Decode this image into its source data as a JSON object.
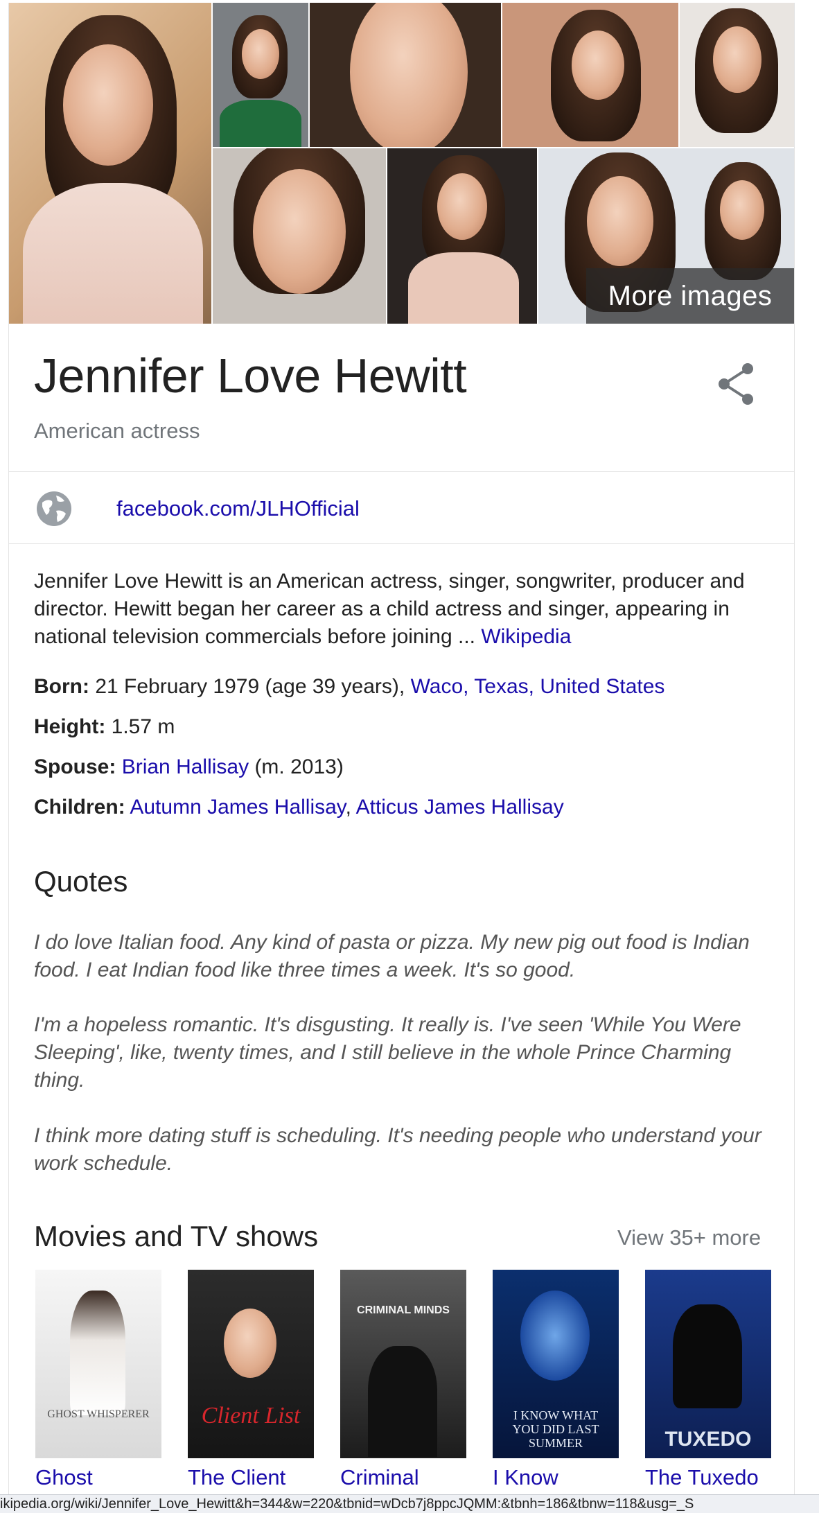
{
  "images": {
    "more_images_label": "More images"
  },
  "entity": {
    "name": "Jennifer Love Hewitt",
    "subtitle": "American actress",
    "website": "facebook.com/JLHOfficial",
    "description": "Jennifer Love Hewitt is an American actress, singer, songwriter, producer and director. Hewitt began her career as a child actress and singer, appearing in national television commercials before joining ... ",
    "description_source": "Wikipedia"
  },
  "facts": {
    "born": {
      "label": "Born:",
      "text": " 21 February 1979 (age 39 years), ",
      "link": "Waco, Texas, United States"
    },
    "height": {
      "label": "Height:",
      "text": " 1.57 m"
    },
    "spouse": {
      "label": "Spouse:",
      "link": "Brian Hallisay",
      "suffix": " (m. 2013)"
    },
    "children": {
      "label": "Children:",
      "link1": "Autumn James Hallisay",
      "sep": ", ",
      "link2": "Atticus James Hallisay"
    }
  },
  "quotes": {
    "title": "Quotes",
    "items": [
      "I do love Italian food. Any kind of pasta or pizza. My new pig out food is Indian food. I eat Indian food like three times a week. It's so good.",
      "I'm a hopeless romantic. It's disgusting. It really is. I've seen 'While You Were Sleeping', like, twenty times, and I still believe in the whole Prince Charming thing.",
      "I think more dating stuff is scheduling. It's needing people who understand your work schedule."
    ]
  },
  "movies": {
    "title": "Movies and TV shows",
    "view_more": "View 35+ more",
    "items": [
      {
        "label": "Ghost",
        "poster_text": "GHOST WHISPERER"
      },
      {
        "label": "The Client",
        "poster_text": "Client List"
      },
      {
        "label": "Criminal",
        "poster_text": "CRIMINAL MINDS"
      },
      {
        "label": "I Know",
        "poster_text": "I KNOW WHAT YOU DID LAST SUMMER"
      },
      {
        "label": "The Tuxedo",
        "poster_text": "TUXEDO"
      }
    ]
  },
  "status_bar": {
    "url": "ikipedia.org/wiki/Jennifer_Love_Hewitt&h=344&w=220&tbnid=wDcb7j8ppcJQMM:&tbnh=186&tbnw=118&usg=_S"
  },
  "colors": {
    "link": "#1a0dab",
    "muted": "#70757a",
    "text": "#222222"
  }
}
